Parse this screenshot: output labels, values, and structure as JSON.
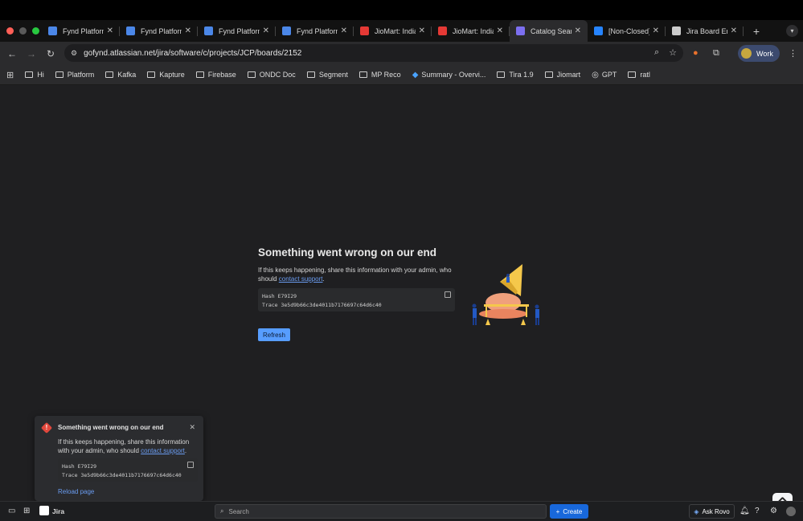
{
  "browser": {
    "tabs": [
      {
        "title": "Fynd Platform",
        "favicon": "fynd-icon",
        "color": "#4b87e8"
      },
      {
        "title": "Fynd Platform",
        "favicon": "fynd-icon",
        "color": "#4b87e8"
      },
      {
        "title": "Fynd Platform",
        "favicon": "fynd-icon",
        "color": "#4b87e8"
      },
      {
        "title": "Fynd Platform",
        "favicon": "fynd-icon",
        "color": "#4b87e8"
      },
      {
        "title": "JioMart: India",
        "favicon": "jiomart-icon",
        "color": "#e53935"
      },
      {
        "title": "JioMart: India",
        "favicon": "jiomart-icon",
        "color": "#e53935"
      },
      {
        "title": "Catalog Search",
        "favicon": "catalog-icon",
        "color": "#7c6ff0"
      },
      {
        "title": "[Non-Closed]",
        "favicon": "jira-icon",
        "color": "#2684ff"
      },
      {
        "title": "Jira Board Error",
        "favicon": "openai-icon",
        "color": "#cccccc"
      }
    ],
    "active_tab_index": 6,
    "new_tab_label": "+",
    "url": "gofynd.atlassian.net/jira/software/c/projects/JCP/boards/2152",
    "profile_label": "Work",
    "bookmarks": [
      {
        "label": "Hi",
        "icon": "folder-icon"
      },
      {
        "label": "Platform",
        "icon": "folder-icon"
      },
      {
        "label": "Kafka",
        "icon": "folder-icon"
      },
      {
        "label": "Kapture",
        "icon": "folder-icon"
      },
      {
        "label": "Firebase",
        "icon": "folder-icon"
      },
      {
        "label": "ONDC Doc",
        "icon": "folder-icon"
      },
      {
        "label": "Segment",
        "icon": "folder-icon"
      },
      {
        "label": "MP Reco",
        "icon": "folder-icon"
      },
      {
        "label": "Summary - Overvi...",
        "icon": "azure-icon"
      },
      {
        "label": "Tira 1.9",
        "icon": "folder-icon"
      },
      {
        "label": "Jiomart",
        "icon": "folder-icon"
      },
      {
        "label": "GPT",
        "icon": "openai-icon"
      },
      {
        "label": "ratl",
        "icon": "folder-icon"
      }
    ]
  },
  "error_page": {
    "title": "Something went wrong on our end",
    "message_prefix": "If this keeps happening, share this information with your admin, who should ",
    "support_link": "contact support",
    "message_suffix": ".",
    "hash_line": "Hash E79I29",
    "trace_line": "Trace 3e5d9b66c3de4011b7176697c64d6c40",
    "refresh_label": "Refresh"
  },
  "toast": {
    "title": "Something went wrong on our end",
    "message_prefix": "If this keeps happening, share this information with your admin, who should ",
    "support_link": "contact support",
    "message_suffix": ".",
    "hash_line": "Hash E79I29",
    "trace_line": "Trace 3e5d9b66c3de4011b7176697c64d6c40",
    "reload_label": "Reload page"
  },
  "jira_bar": {
    "app_name": "Jira",
    "search_placeholder": "Search",
    "create_label": "Create",
    "ask_rovo_label": "Ask Rovo"
  },
  "colors": {
    "accent": "#579dff",
    "create_button": "#1868db",
    "error_icon": "#e2483d",
    "link": "#6a9cf0"
  }
}
